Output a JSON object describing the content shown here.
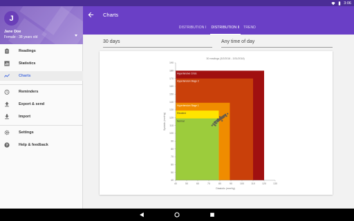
{
  "status_bar": {
    "time": "3:06"
  },
  "drawer": {
    "avatar_initial": "J",
    "user_name": "Jane Doe",
    "user_details": "Female - 38 years old",
    "items": [
      {
        "label": "Readings",
        "icon": "clipboard-icon"
      },
      {
        "label": "Statistics",
        "icon": "bar-chart-icon"
      },
      {
        "label": "Charts",
        "icon": "line-chart-icon"
      },
      {
        "label": "Reminders",
        "icon": "alarm-icon"
      },
      {
        "label": "Export & send",
        "icon": "upload-icon"
      },
      {
        "label": "Import",
        "icon": "download-icon"
      },
      {
        "label": "Settings",
        "icon": "gear-icon"
      },
      {
        "label": "Help & feedback",
        "icon": "help-icon"
      }
    ],
    "active_item": "Charts"
  },
  "appbar": {
    "title": "Charts",
    "tabs": [
      {
        "label": "DISTRIBUTION I"
      },
      {
        "label": "DISTRIBUTION II"
      },
      {
        "label": "TREND"
      }
    ],
    "active_tab": "DISTRIBUTION II"
  },
  "filters": {
    "period": "30 days",
    "time_of_day": "Any time of day"
  },
  "chart_data": {
    "type": "scatter",
    "title": "30 readings (3/2/2018 - 3/31/2018)",
    "xlabel": "Diastolic (mmHg)",
    "ylabel": "Systolic (mmHg)",
    "xlim": [
      40,
      130
    ],
    "ylim": [
      40,
      190
    ],
    "x_ticks": [
      "40",
      "50",
      "60",
      "70",
      "80",
      "90",
      "100",
      "110",
      "120",
      "130"
    ],
    "y_ticks": [
      "40",
      "50",
      "60",
      "70",
      "80",
      "90",
      "100",
      "110",
      "120",
      "130",
      "140",
      "150",
      "160",
      "170",
      "180",
      "190"
    ],
    "zones": [
      {
        "label": "Hypertensive Crisis",
        "x_max": 120,
        "y_max": 180,
        "color": "#a01010"
      },
      {
        "label": "Hypertension Stage 2",
        "x_max": 110,
        "y_max": 170,
        "color": "#c9400a"
      },
      {
        "label": "Hypertension Stage 1",
        "x_max": 89,
        "y_max": 139,
        "color": "#f08c00"
      },
      {
        "label": "Elevated",
        "x_max": 79,
        "y_max": 129,
        "color": "#ffe400"
      },
      {
        "label": "Normal",
        "x_max": 79,
        "y_max": 119,
        "color": "#9ccc3c"
      }
    ],
    "points": [
      [
        74,
        112
      ],
      [
        75,
        114
      ],
      [
        76,
        115
      ],
      [
        77,
        116
      ],
      [
        78,
        117
      ],
      [
        79,
        118
      ],
      [
        80,
        119
      ],
      [
        81,
        120
      ],
      [
        82,
        121
      ],
      [
        83,
        122
      ],
      [
        84,
        123
      ],
      [
        85,
        124
      ],
      [
        76,
        113
      ],
      [
        78,
        115
      ],
      [
        80,
        117
      ],
      [
        82,
        119
      ],
      [
        84,
        121
      ],
      [
        86,
        122
      ],
      [
        73,
        110
      ],
      [
        75,
        111
      ],
      [
        77,
        113
      ],
      [
        79,
        116
      ],
      [
        81,
        118
      ],
      [
        83,
        120
      ],
      [
        85,
        123
      ],
      [
        87,
        125
      ],
      [
        78,
        118
      ],
      [
        80,
        121
      ],
      [
        82,
        116
      ],
      [
        76,
        110
      ]
    ],
    "point_color": "#555555"
  }
}
